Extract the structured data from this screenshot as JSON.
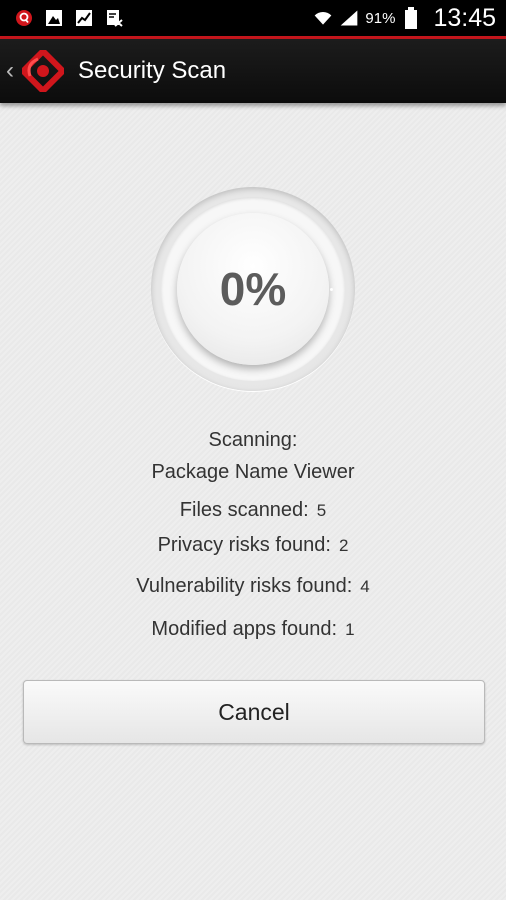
{
  "status_bar": {
    "icons": [
      "app-alert-icon",
      "image-icon",
      "chart-icon",
      "no-file-icon"
    ],
    "battery_percent": "91%",
    "time": "13:45"
  },
  "action_bar": {
    "title": "Security Scan"
  },
  "scan": {
    "progress_percent": "0%",
    "progress_value": 0,
    "scanning_label": "Scanning:",
    "current_item": "Package Name Viewer",
    "stats": [
      {
        "label": "Files scanned:",
        "value": "5"
      },
      {
        "label": "Privacy risks found:",
        "value": "2"
      },
      {
        "label": "Vulnerability risks found:",
        "value": "4"
      },
      {
        "label": "Modified apps found:",
        "value": "1"
      }
    ]
  },
  "buttons": {
    "cancel_label": "Cancel"
  },
  "colors": {
    "accent": "#c4161c",
    "actionbar_bg": "#111111",
    "background": "#ececec"
  }
}
